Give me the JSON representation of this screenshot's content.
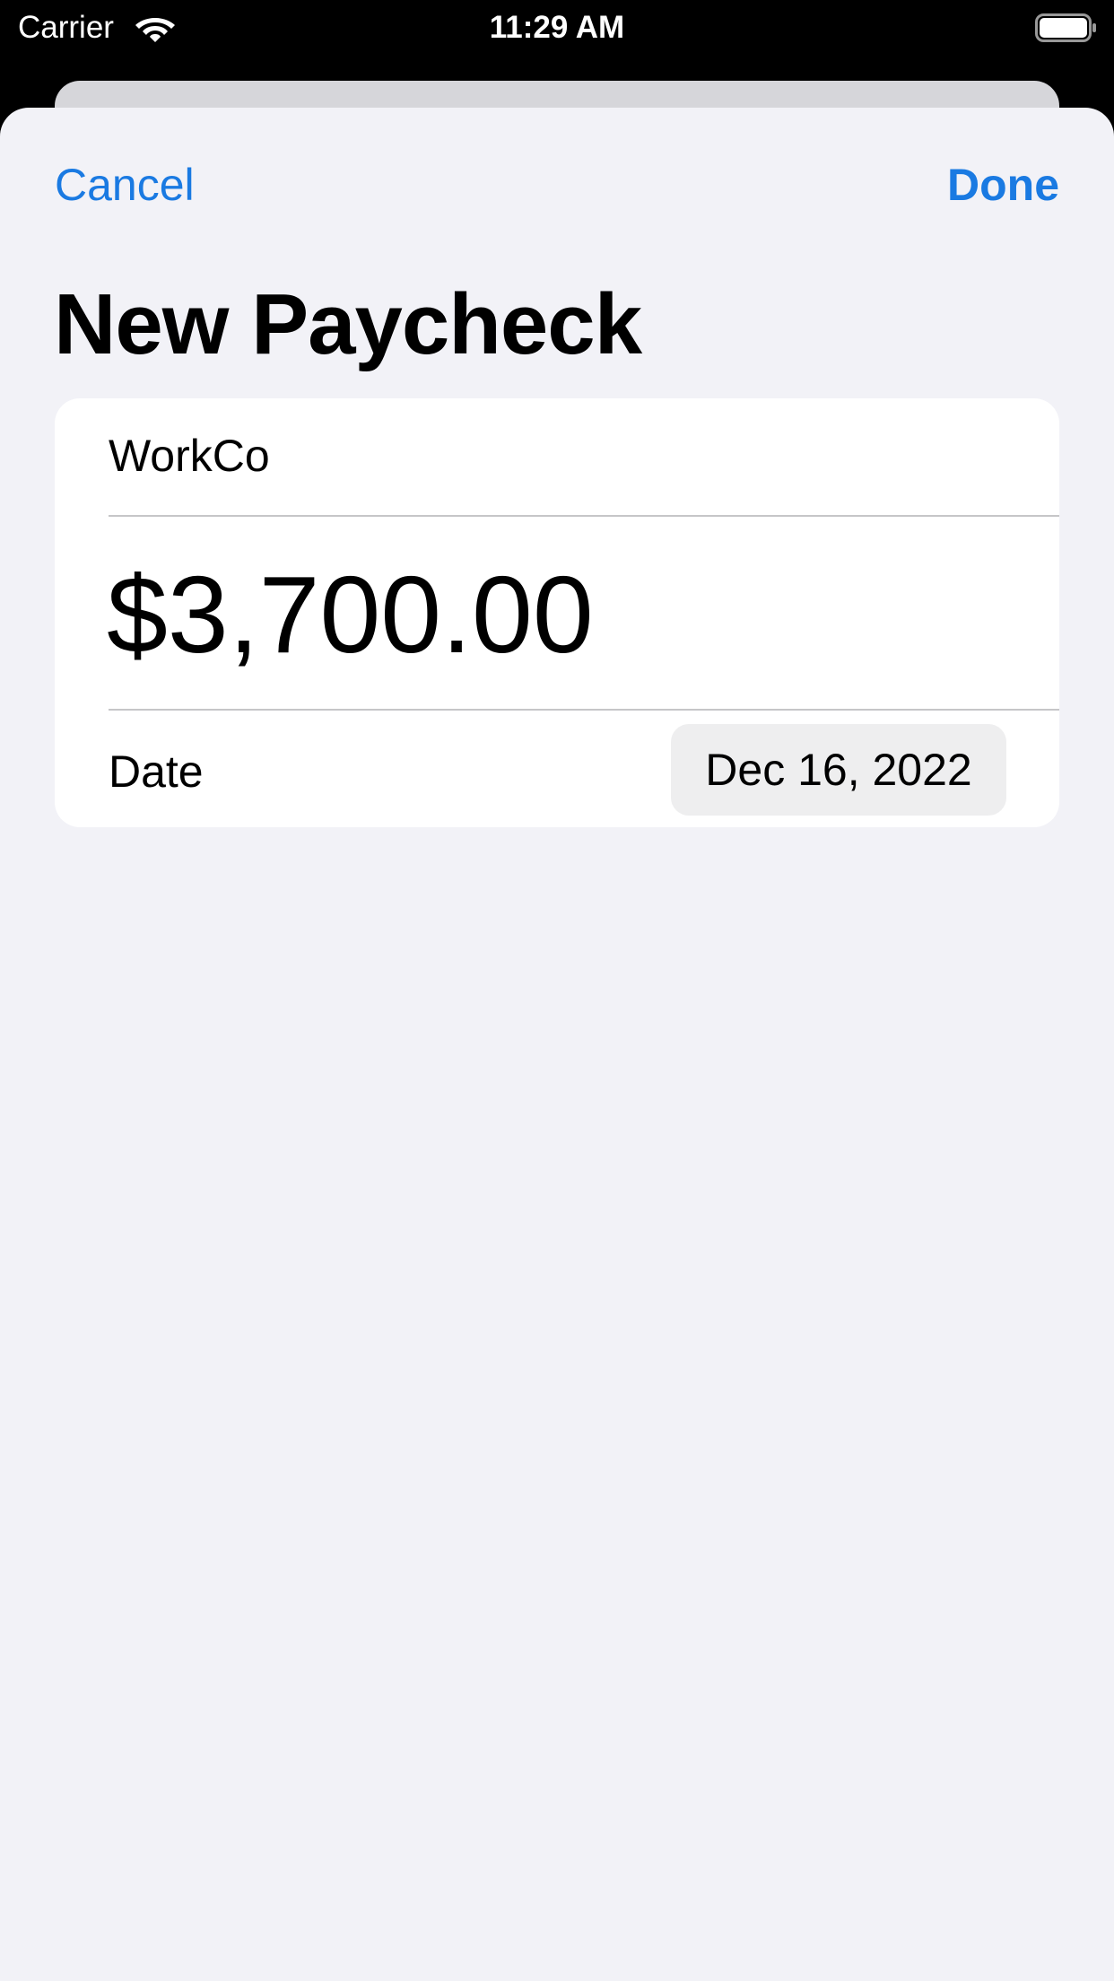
{
  "status_bar": {
    "carrier": "Carrier",
    "time": "11:29 AM",
    "wifi_icon": "wifi-icon",
    "battery_icon": "battery-icon"
  },
  "nav": {
    "cancel_label": "Cancel",
    "done_label": "Done"
  },
  "page": {
    "title": "New Paycheck"
  },
  "form": {
    "employer_value": "WorkCo",
    "amount_value": "$3,700.00",
    "date_label": "Date",
    "date_value": "Dec 16, 2022"
  },
  "colors": {
    "accent": "#1a7ae2",
    "sheet_background": "#f2f2f7",
    "card_background": "#ffffff",
    "date_chip_background": "#eeeeef"
  }
}
